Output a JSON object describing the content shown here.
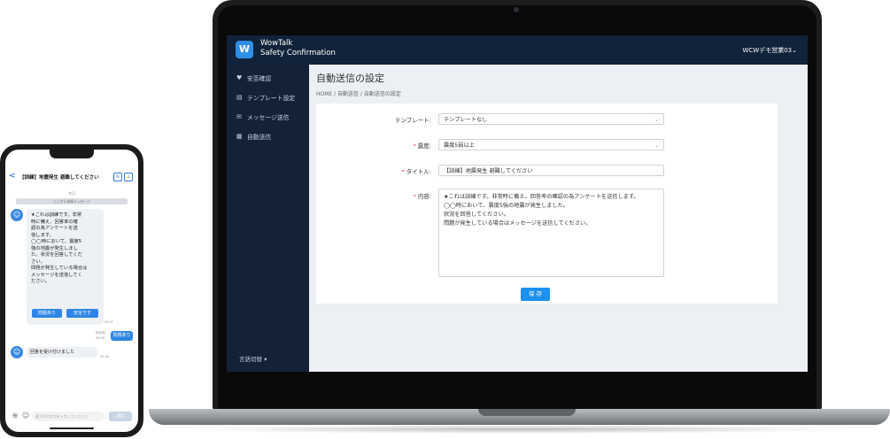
{
  "laptop": {
    "app": {
      "name_line1": "WowTalk",
      "name_line2": "Safety Confirmation",
      "account": "WCWデモ営業03"
    },
    "sidebar": {
      "items": [
        {
          "label": "安否確認",
          "icon": "heart-icon"
        },
        {
          "label": "テンプレート設定",
          "icon": "template-icon"
        },
        {
          "label": "メッセージ送信",
          "icon": "mail-icon"
        },
        {
          "label": "自動送信",
          "icon": "calendar-icon"
        }
      ],
      "language": "言語切替"
    },
    "main": {
      "title": "自動送信の設定",
      "breadcrumb": "HOME / 自動送信 / 自動送信の設定",
      "form": {
        "template_label": "テンプレート:",
        "template_value": "テンプレートなし",
        "shindo_label": "震度:",
        "shindo_value": "震度5弱以上",
        "title_label": "タイトル:",
        "title_value": "【訓練】地震発生 避難してください",
        "content_label": "内容:",
        "content_lines": [
          "★これは訓練です。非常時に備え、回答率の確認の為アンケートを送信します。",
          "",
          "◯◯時において、震度5強の地震が発生しました。",
          "状況を回答してください。",
          "",
          "問題が発生している場合はメッセージを送信してください。"
        ],
        "required_mark": "*",
        "save_button": "保 存"
      }
    }
  },
  "phone": {
    "header_title": "【訓練】地震発生 避難してください",
    "back": "<",
    "date": "今日",
    "unread": "ここから未読メッセージ",
    "message_lines": [
      "★これは訓練です。非常",
      "時に備え、回答率の確",
      "認の為アンケートを送",
      "信します。",
      "",
      "◯◯時において、震度5",
      "強の地震が発生しまし",
      "た。状況を回答してくだ",
      "さい。",
      "",
      "問題が発生している場合は",
      "メッセージを送信してく",
      "ださい。"
    ],
    "btn_problem": "問題あり",
    "btn_safe": "安全です",
    "time1": "08:37",
    "sent_meta_1": "既読済",
    "sent_meta_2": "08:38",
    "sent_message": "問題あり",
    "reply": "回答を受け付けました",
    "time2": "08:38",
    "input_placeholder": "最大500文字を入力してください",
    "send": "送信"
  }
}
